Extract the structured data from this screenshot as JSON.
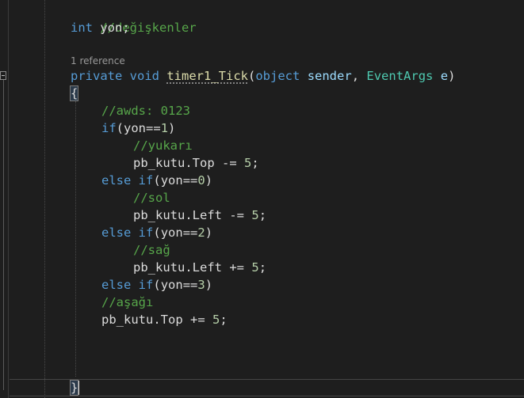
{
  "codelens": {
    "references": "1 reference"
  },
  "code": {
    "l1_comment": "//değişkenler",
    "l2_kw": "int",
    "l2_ident": "yon",
    "l2_semi": ";",
    "l4_private": "private",
    "l4_void": "void",
    "l4_method": "timer1_Tick",
    "l4_paren_open": "(",
    "l4_object": "object",
    "l4_sender": "sender",
    "l4_comma": ",",
    "l4_eventargs": "EventArgs",
    "l4_e": "e",
    "l4_paren_close": ")",
    "l5_brace_open": "{",
    "l6_comment": "//awds: 0123",
    "l7_if": "if",
    "l7_cond_open": "(",
    "l7_var": "yon",
    "l7_op": "==",
    "l7_num": "1",
    "l7_cond_close": ")",
    "l8_comment": "//yukarı",
    "l9_obj": "pb_kutu",
    "l9_dot": ".",
    "l9_prop": "Top",
    "l9_op": "-=",
    "l9_num": "5",
    "l9_semi": ";",
    "l10_else": "else",
    "l10_if": "if",
    "l10_cond_open": "(",
    "l10_var": "yon",
    "l10_op": "==",
    "l10_num": "0",
    "l10_cond_close": ")",
    "l11_comment": "//sol",
    "l12_obj": "pb_kutu",
    "l12_dot": ".",
    "l12_prop": "Left",
    "l12_op": "-=",
    "l12_num": "5",
    "l12_semi": ";",
    "l13_else": "else",
    "l13_if": "if",
    "l13_cond_open": "(",
    "l13_var": "yon",
    "l13_op": "==",
    "l13_num": "2",
    "l13_cond_close": ")",
    "l14_comment": "//sağ",
    "l15_obj": "pb_kutu",
    "l15_dot": ".",
    "l15_prop": "Left",
    "l15_op": "+=",
    "l15_num": "5",
    "l15_semi": ";",
    "l16_else": "else",
    "l16_if": "if",
    "l16_cond_open": "(",
    "l16_var": "yon",
    "l16_op": "==",
    "l16_num": "3",
    "l16_cond_close": ")",
    "l17_comment": "//aşağı",
    "l18_obj": "pb_kutu",
    "l18_dot": ".",
    "l18_prop": "Top",
    "l18_op": "+=",
    "l18_num": "5",
    "l18_semi": ";",
    "l22_brace_close": "}"
  },
  "colors": {
    "background": "#1e1e1e",
    "comment": "#57a64a",
    "keyword": "#569cd6",
    "type": "#4ec9b0",
    "method": "#dcdcaa",
    "parameter": "#9cdcfe",
    "number": "#b5cea8",
    "text": "#dcdcdc"
  }
}
